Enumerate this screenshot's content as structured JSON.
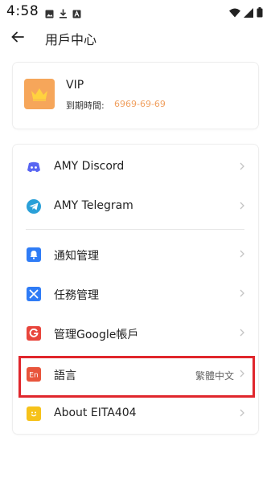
{
  "status_bar": {
    "time": "4:58",
    "left_icons": [
      "image-icon",
      "download-icon",
      "font-icon"
    ],
    "right_icons": [
      "wifi-icon",
      "signal-icon",
      "battery-icon"
    ]
  },
  "app_bar": {
    "title": "用戶中心"
  },
  "vip": {
    "title": "VIP",
    "expire_label": "到期時間:",
    "expire_value": "6969-69-69",
    "icon": "crown-icon",
    "icon_color": "#f6a65a"
  },
  "menu": {
    "items": [
      {
        "label": "AMY Discord",
        "icon": "discord-icon",
        "color": "#5865f2"
      },
      {
        "label": "AMY Telegram",
        "icon": "telegram-icon",
        "color": "#2aa0d8"
      },
      {
        "label": "通知管理",
        "icon": "bell-icon",
        "color": "#2f7cf6"
      },
      {
        "label": "任務管理",
        "icon": "tools-icon",
        "color": "#2f7cf6"
      },
      {
        "label": "管理Google帳戶",
        "icon": "google-icon",
        "color": "#e8453c"
      },
      {
        "label": "語言",
        "value": "繁體中文",
        "icon": "language-icon",
        "color": "#e8553c"
      },
      {
        "label": "About EITA404",
        "icon": "smile-icon",
        "color": "#f6c21a"
      }
    ]
  },
  "highlight_color": "#e0262c"
}
